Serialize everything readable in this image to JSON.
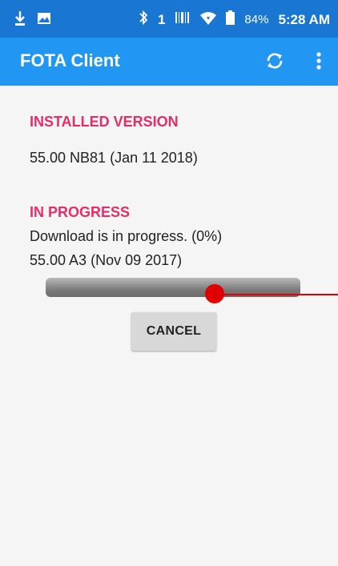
{
  "status_bar": {
    "signal_number": "1",
    "battery_percent": "84%",
    "time": "5:28 AM"
  },
  "app_bar": {
    "title": "FOTA Client",
    "icons": [
      "sync-icon",
      "more-vert-icon"
    ]
  },
  "installed": {
    "heading": "INSTALLED VERSION",
    "version": "55.00 NB81 (Jan 11 2018)"
  },
  "progress": {
    "heading": "IN PROGRESS",
    "status": "Download is in progress. (0%)",
    "version": "55.00 A3 (Nov 09 2017)",
    "value_percent": 0
  },
  "cancel_label": "CANCEL",
  "colors": {
    "status_bar": "#1976d2",
    "app_bar": "#2196f3",
    "accent": "#e52d68",
    "annotation": "#e00000"
  }
}
